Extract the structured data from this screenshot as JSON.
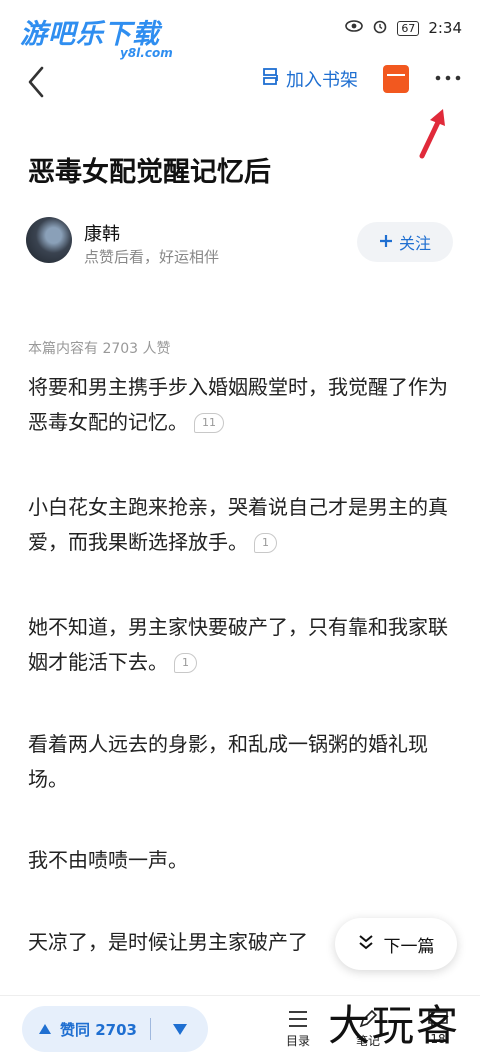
{
  "watermark": {
    "logo": "游吧乐下载",
    "sub": "y8l.com",
    "corner": "大玩客"
  },
  "status": {
    "battery": "67",
    "time": "2:34"
  },
  "header": {
    "shelf_label": "加入书架"
  },
  "article": {
    "title": "恶毒女配觉醒记忆后",
    "likes_note": "本篇内容有 2703 人赞",
    "paragraphs": [
      {
        "text": "将要和男主携手步入婚姻殿堂时，我觉醒了作为恶毒女配的记忆。",
        "comments": "11"
      },
      {
        "text": "小白花女主跑来抢亲，哭着说自己才是男主的真爱，而我果断选择放手。",
        "comments": "1"
      },
      {
        "text": "她不知道，男主家快要破产了，只有靠和我家联姻才能活下去。",
        "comments": "1"
      },
      {
        "text": "看着两人远去的身影，和乱成一锅粥的婚礼现场。",
        "comments": ""
      },
      {
        "text": "我不由啧啧一声。",
        "comments": ""
      },
      {
        "text": "天凉了，是时候让男主家破产了",
        "comments": ""
      }
    ]
  },
  "author": {
    "name": "康韩",
    "subtitle": "点赞后看，好运相伴",
    "follow_label": "关注"
  },
  "next_label": "下一篇",
  "bottom": {
    "like_label": "赞同 2703",
    "toc_label": "目录",
    "notes_label": "笔记",
    "more_label": "18"
  },
  "colors": {
    "accent": "#1f6fd1",
    "redpacket": "#f2581f",
    "annotation_arrow": "#e02a3a"
  }
}
